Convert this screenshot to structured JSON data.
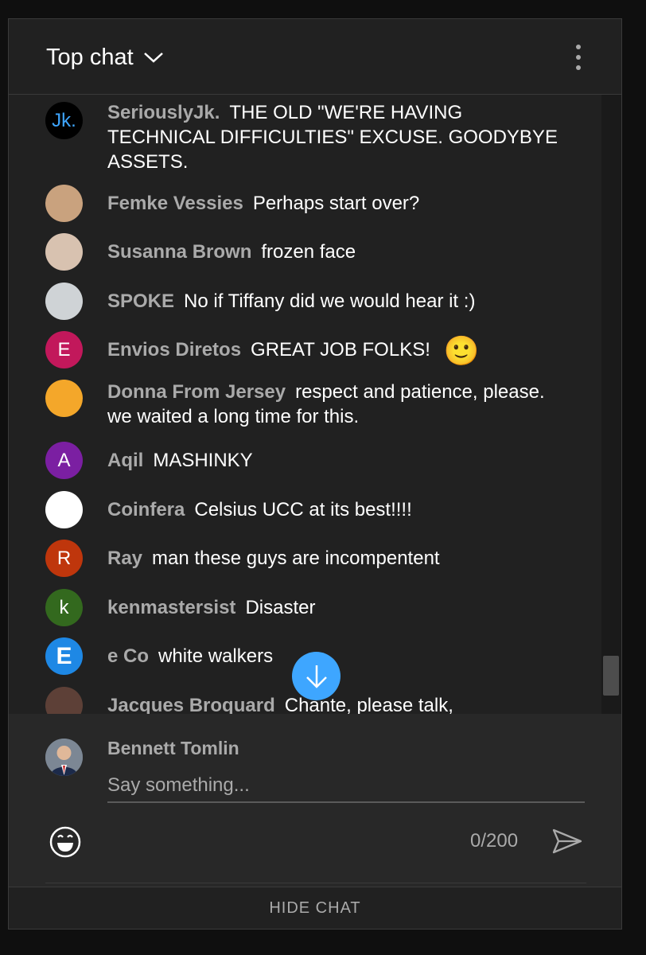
{
  "header": {
    "title": "Top chat",
    "dropdown_icon": "chevron-down-icon",
    "more_icon": "more-vert-icon"
  },
  "messages": [
    {
      "author": "SeriouslyJk.",
      "text": "THE OLD \"WE'RE HAVING TECHNICAL DIFFICULTIES\" EXCUSE. GOODYBYE ASSETS.",
      "avatar_text": "Jk.",
      "avatar_color": "#000000",
      "avatar_text_color": "#3ea6ff"
    },
    {
      "author": "Femke Vessies",
      "text": "Perhaps start over?",
      "avatar_text": "",
      "avatar_color": "#c9a27e"
    },
    {
      "author": "Susanna Brown",
      "text": "frozen face",
      "avatar_text": "",
      "avatar_color": "#d8c2b0"
    },
    {
      "author": "SPOKE",
      "text": "No if Tiffany did we would hear it :)",
      "avatar_text": "",
      "avatar_color": "#cfd3d6"
    },
    {
      "author": "Envios Diretos",
      "text": "GREAT JOB FOLKS!",
      "emoji": "🙂",
      "avatar_text": "E",
      "avatar_color": "#c2185b"
    },
    {
      "author": "Donna From Jersey",
      "text": "respect and patience, please. we waited a long time for this.",
      "avatar_text": "",
      "avatar_color": "#f4a72a"
    },
    {
      "author": "Aqil",
      "text": "MASHINKY",
      "avatar_text": "A",
      "avatar_color": "#7b1fa2"
    },
    {
      "author": "Coinfera",
      "text": "Celsius UCC at its best!!!!",
      "avatar_text": "",
      "avatar_color": "#ffffff"
    },
    {
      "author": "Ray",
      "text": "man these guys are incompentent",
      "avatar_text": "R",
      "avatar_color": "#bf360c"
    },
    {
      "author": "kenmastersist",
      "text": "Disaster",
      "avatar_text": "k",
      "avatar_color": "#33691e"
    },
    {
      "author": "e Co",
      "text": "white walkers",
      "avatar_text": "E",
      "avatar_color": "#1e88e5"
    },
    {
      "author": "Jacques Broquard",
      "text": "Chante, please talk,",
      "avatar_text": "",
      "avatar_color": "#5d4037"
    }
  ],
  "jump_button_icon": "arrow-down-icon",
  "composer": {
    "user_name": "Bennett Tomlin",
    "placeholder": "Say something...",
    "counter": "0/200",
    "emoji_icon": "emoji-icon",
    "send_icon": "send-icon"
  },
  "footer": {
    "hide_chat_label": "HIDE CHAT"
  }
}
